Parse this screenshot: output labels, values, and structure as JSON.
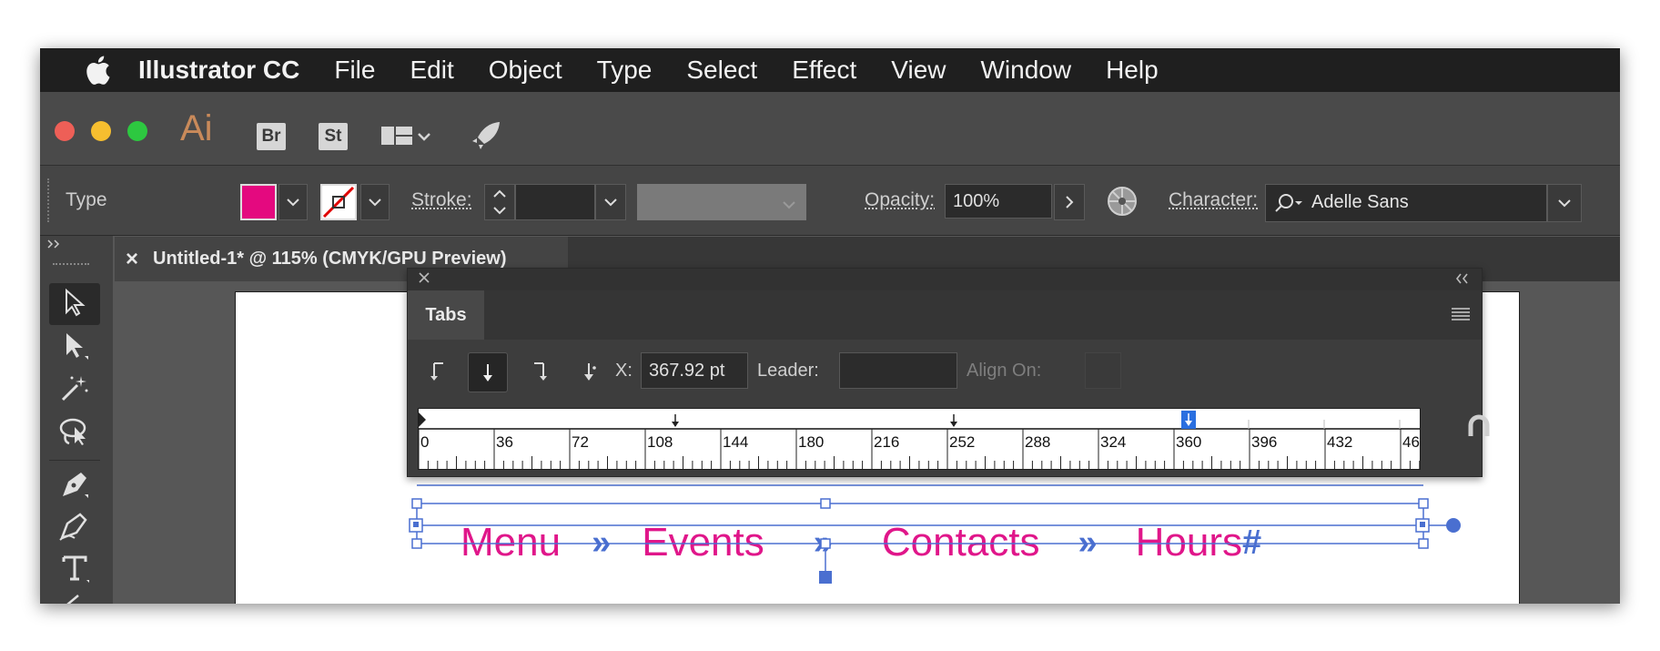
{
  "menubar": {
    "app_name": "Illustrator CC",
    "items": [
      "File",
      "Edit",
      "Object",
      "Type",
      "Select",
      "Effect",
      "View",
      "Window",
      "Help"
    ]
  },
  "appbar": {
    "logo": "Ai",
    "bridge": "Br",
    "stock": "St",
    "traffic_colors": {
      "close": "#ee5f57",
      "minimize": "#f6be2f",
      "zoom": "#2dc840"
    }
  },
  "control": {
    "mode_label": "Type",
    "fill_color": "#e4097f",
    "stroke_label": "Stroke:",
    "opacity_label": "Opacity:",
    "opacity_value": "100%",
    "character_label": "Character:",
    "font_value": "Adelle Sans"
  },
  "document": {
    "tab_title": "Untitled-1* @ 115% (CMYK/GPU Preview)",
    "close_glyph": "×"
  },
  "tabs_panel": {
    "title": "Tabs",
    "x_label": "X:",
    "x_value": "367.92 pt",
    "leader_label": "Leader:",
    "leader_value": "",
    "align_label": "Align On:",
    "align_value": "",
    "ruler_ticks": [
      "0",
      "36",
      "72",
      "108",
      "144",
      "180",
      "216",
      "252",
      "288",
      "324",
      "360",
      "396",
      "432",
      "46"
    ]
  },
  "artwork": {
    "words": [
      "Menu",
      "Events",
      "Contacts",
      "Hours"
    ],
    "separator": "»",
    "end_mark": "#",
    "text_color": "#e0168a",
    "selection_color": "#4a6fd0"
  }
}
